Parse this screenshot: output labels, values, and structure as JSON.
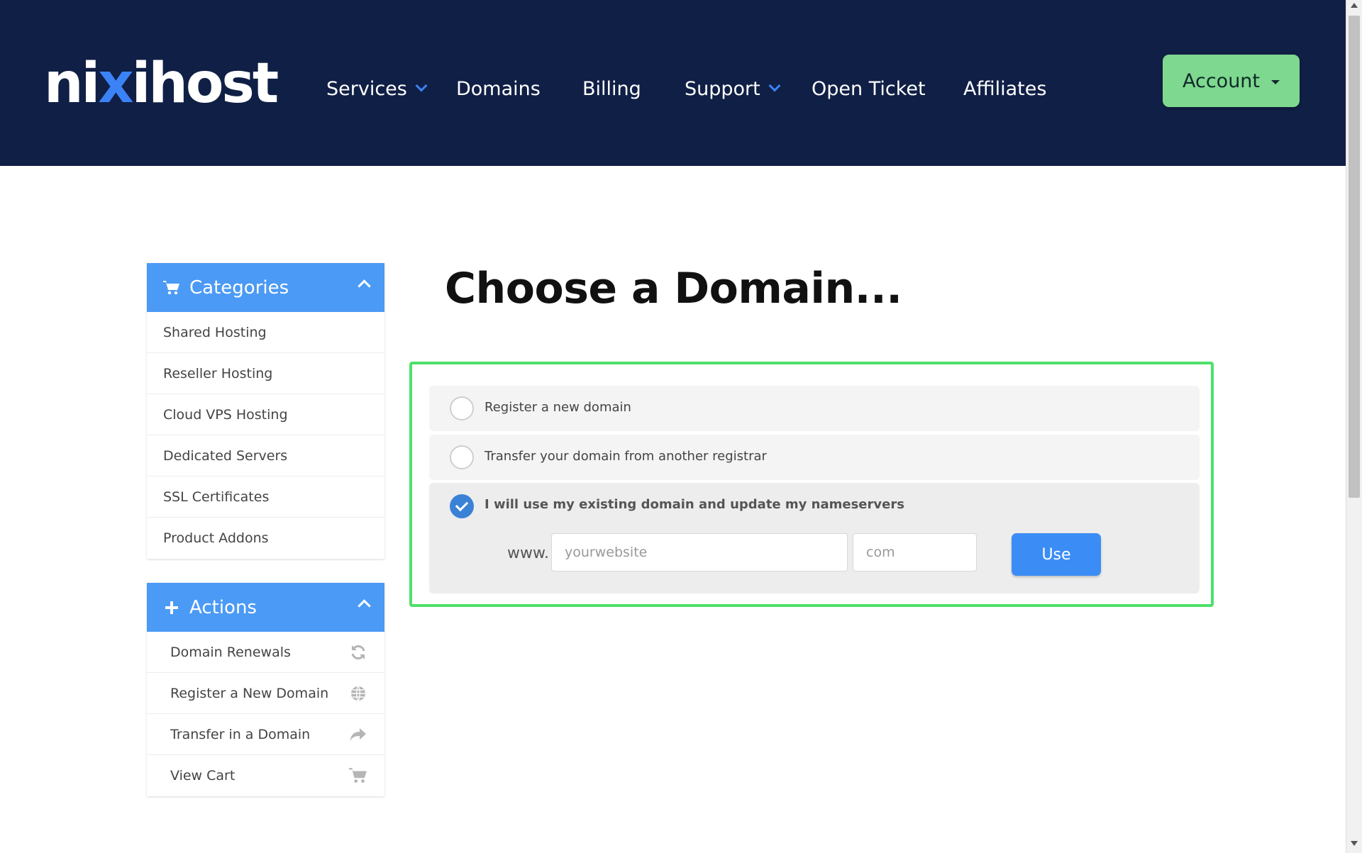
{
  "header": {
    "logo": {
      "part1": "ni",
      "part2": "x",
      "part3": "ihost"
    },
    "nav": [
      {
        "label": "Services",
        "dropdown": true
      },
      {
        "label": "Domains",
        "dropdown": false
      },
      {
        "label": "Billing",
        "dropdown": false
      },
      {
        "label": "Support",
        "dropdown": true
      },
      {
        "label": "Open Ticket",
        "dropdown": false
      },
      {
        "label": "Affiliates",
        "dropdown": false
      }
    ],
    "account_label": "Account"
  },
  "sidebar": {
    "categories": {
      "title": "Categories",
      "icon": "shopping-cart-icon",
      "items": [
        "Shared Hosting",
        "Reseller Hosting",
        "Cloud VPS Hosting",
        "Dedicated Servers",
        "SSL Certificates",
        "Product Addons"
      ]
    },
    "actions": {
      "title": "Actions",
      "icon": "plus-icon",
      "items": [
        {
          "label": "Domain Renewals",
          "icon": "refresh-icon"
        },
        {
          "label": "Register a New Domain",
          "icon": "globe-icon"
        },
        {
          "label": "Transfer in a Domain",
          "icon": "share-arrow-icon"
        },
        {
          "label": "View Cart",
          "icon": "shopping-cart-icon"
        }
      ]
    }
  },
  "main": {
    "title": "Choose a Domain...",
    "options": [
      {
        "label": "Register a new domain",
        "selected": false
      },
      {
        "label": "Transfer your domain from another registrar",
        "selected": false
      },
      {
        "label": "I will use my existing domain and update my nameservers",
        "selected": true
      }
    ],
    "domain_form": {
      "prefix": "www.",
      "name_placeholder": "yourwebsite",
      "name_value": "",
      "tld_placeholder": "com",
      "tld_value": "",
      "button_label": "Use"
    }
  },
  "colors": {
    "header_bg": "#101f45",
    "accent_blue": "#3b82f6",
    "panel_head": "#4b9af5",
    "account_green": "#7ed88f",
    "highlight_border": "#4ee06a",
    "use_button": "#3b8df5"
  }
}
